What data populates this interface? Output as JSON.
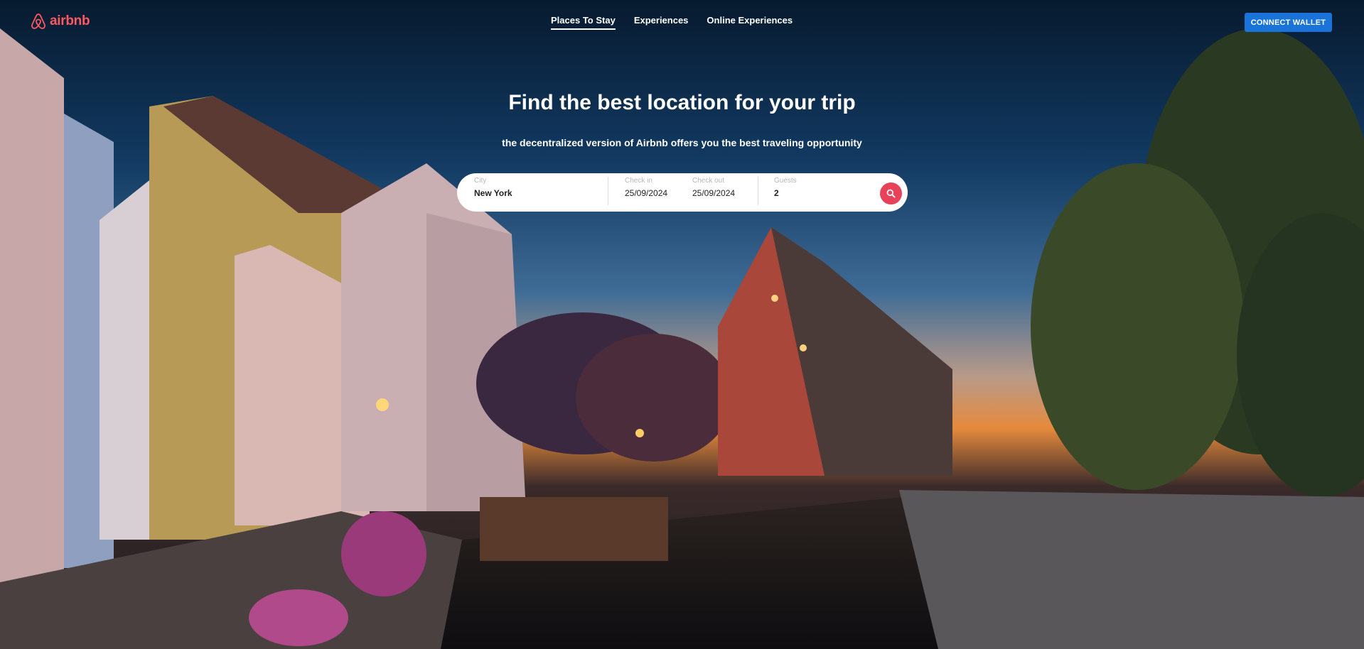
{
  "app": {
    "logo_text": "airbnb",
    "brand_color": "#ff5a5f",
    "logo_icon": "airbnb-belo-icon"
  },
  "nav": {
    "items": [
      {
        "label": "Places To Stay",
        "active": true
      },
      {
        "label": "Experiences",
        "active": false
      },
      {
        "label": "Online Experiences",
        "active": false
      }
    ]
  },
  "header": {
    "wallet_button": "CONNECT WALLET",
    "wallet_color": "#1a73d9"
  },
  "hero": {
    "title": "Find the best location for your trip",
    "subtitle": "the decentralized version of Airbnb offers you the best traveling opportunity"
  },
  "search": {
    "city": {
      "label": "City",
      "value": "New York"
    },
    "checkin": {
      "label": "Check in",
      "value": "25/09/2024"
    },
    "checkout": {
      "label": "Check out",
      "value": "25/09/2024"
    },
    "guests": {
      "label": "Guests",
      "value": "2"
    },
    "button_icon": "search-icon",
    "button_color": "#e8425a"
  }
}
